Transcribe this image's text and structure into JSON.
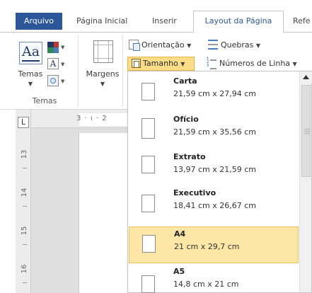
{
  "tabs": {
    "file": "Arquivo",
    "home": "Página Inicial",
    "insert": "Inserir",
    "layout": "Layout da Página",
    "references_partial": "Refe"
  },
  "ribbon": {
    "themes_label": "Temas",
    "margins_label": "Margens",
    "group_themes": "Temas",
    "orientation_label": "Orientação",
    "breaks_label": "Quebras",
    "size_label": "Tamanho",
    "line_numbers_label": "Números de Linha"
  },
  "ruler": {
    "top_text": "3 · ı · 2",
    "corner": "L",
    "vertical_numbers": [
      "13",
      "14",
      "15",
      "16"
    ]
  },
  "size_menu": {
    "items": [
      {
        "name": "Carta",
        "dims": "21,59 cm x 27,94 cm",
        "selected": false
      },
      {
        "name": "Ofício",
        "dims": "21,59 cm x 35,56 cm",
        "selected": false
      },
      {
        "name": "Extrato",
        "dims": "13,97 cm x 21,59 cm",
        "selected": false
      },
      {
        "name": "Executivo",
        "dims": "18,41 cm x 26,67 cm",
        "selected": false
      },
      {
        "name": "A4",
        "dims": "21 cm x 29,7 cm",
        "selected": true
      },
      {
        "name": "A5",
        "dims": "14,8 cm x 21 cm",
        "selected": false
      }
    ]
  },
  "colors": {
    "accent_file_tab": "#2b579a",
    "highlight": "#fde6a6",
    "size_button": "#fbdc87"
  }
}
